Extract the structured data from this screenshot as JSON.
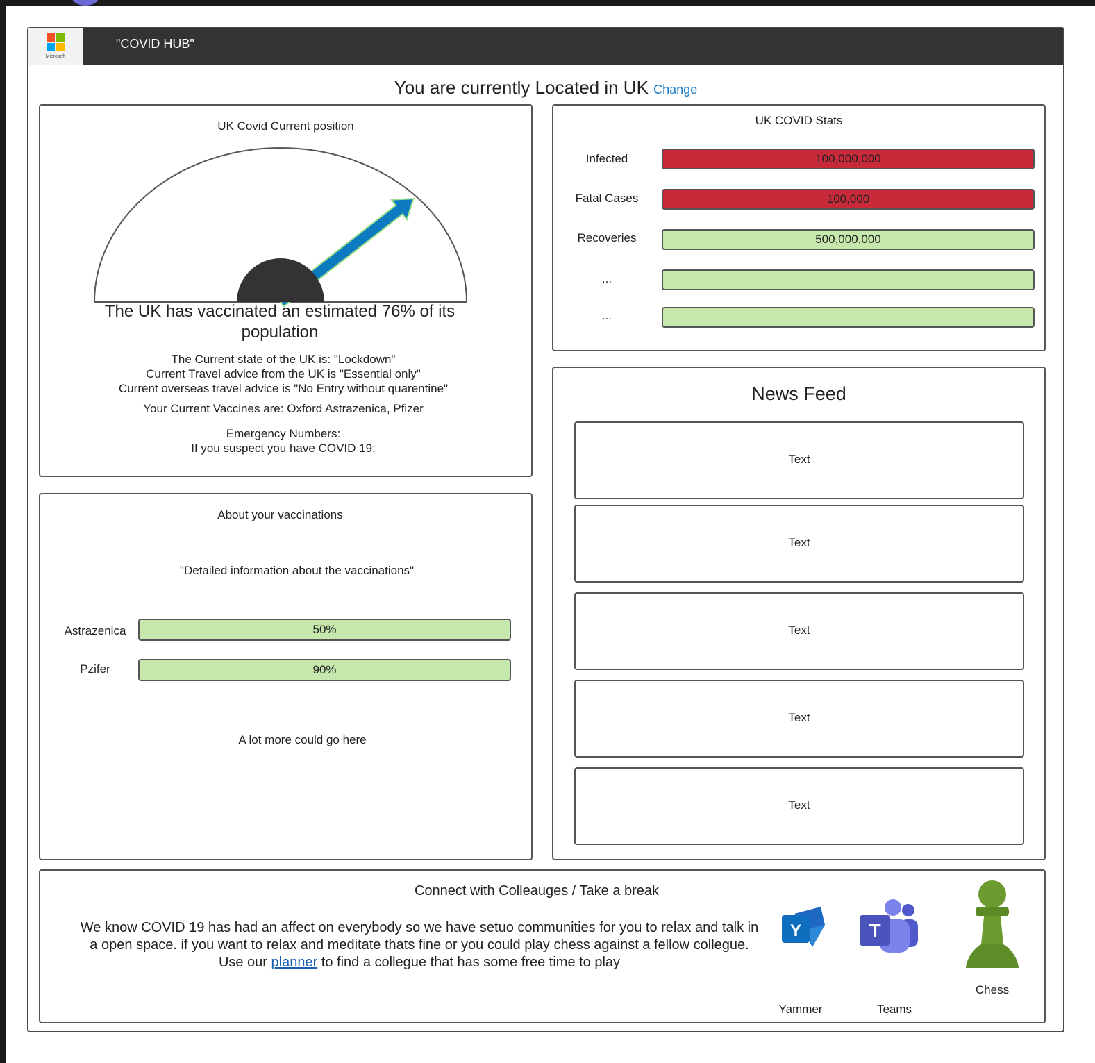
{
  "app": {
    "logo_text": "Microsoft",
    "title": "\"COVID HUB\""
  },
  "location": {
    "text": "You are currently Located in UK",
    "change_label": "Change"
  },
  "gauge_panel": {
    "title": "UK Covid Current position",
    "gauge_value_percent": 76,
    "headline": "The UK has vaccinated an estimated 76% of its population",
    "state_line": "The Current state of the UK is: \"Lockdown\"",
    "travel_line": "Current Travel advice from the UK is \"Essential only\"",
    "overseas_line": "Current overseas travel advice is \"No Entry without quarentine\"",
    "vaccines_line": "Your Current Vaccines are: Oxford Astrazenica, Pfizer",
    "emergency_line": "Emergency Numbers:",
    "suspect_line": "If you suspect you have COVID 19:"
  },
  "stats_panel": {
    "title": "UK COVID Stats",
    "rows": [
      {
        "label": "Infected",
        "value": "100,000,000",
        "color": "#c82a3a"
      },
      {
        "label": "Fatal Cases",
        "value": "100,000",
        "color": "#c82a3a"
      },
      {
        "label": "Recoveries",
        "value": "500,000,000",
        "color": "#c6e8ad"
      },
      {
        "label": "...",
        "value": "",
        "color": "#c6e8ad"
      },
      {
        "label": "...",
        "value": "",
        "color": "#c6e8ad"
      }
    ]
  },
  "about_panel": {
    "title": "About your vaccinations",
    "detail": "\"Detailed information about the vaccinations\"",
    "vaccines": [
      {
        "label": "Astrazenica",
        "value": "50%"
      },
      {
        "label": "Pzifer",
        "value": "90%"
      }
    ],
    "more": "A lot more could go here"
  },
  "news_panel": {
    "title": "News Feed",
    "items": [
      "Text",
      "Text",
      "Text",
      "Text",
      "Text"
    ]
  },
  "connect_panel": {
    "title": "Connect with Colleauges  / Take a break",
    "line1": "We know COVID 19 has had an affect on everybody so we have setuo communities for you to relax and talk in",
    "line2": "a open space. if you want to relax and meditate thats fine or you could play chess against a fellow collegue.",
    "line3_before": "Use our ",
    "line3_link": "planner",
    "line3_after": " to find a collegue that has some free time to play",
    "apps": [
      {
        "label": "Yammer",
        "icon": "yammer-icon"
      },
      {
        "label": "Teams",
        "icon": "teams-icon"
      },
      {
        "label": "Chess",
        "icon": "chess-pawn-icon"
      }
    ]
  },
  "colors": {
    "header": "#333333",
    "link": "#1a7ac4",
    "red_bar": "#c82a3a",
    "green_bar": "#c6e8ad",
    "needle": "#0e7ac0"
  }
}
